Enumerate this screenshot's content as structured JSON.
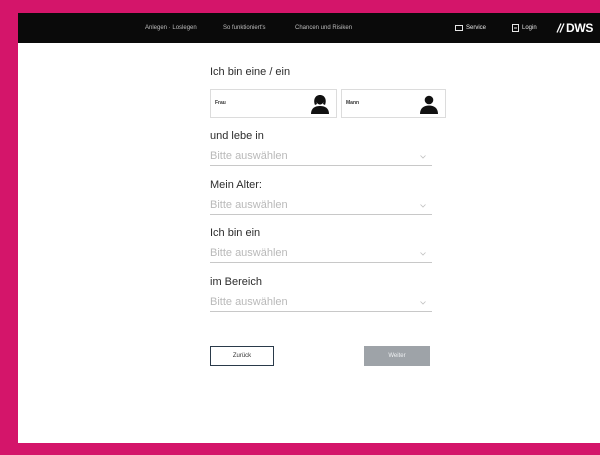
{
  "nav": {
    "links": [
      "Anlegen · Loslegen",
      "So funktioniert's",
      "Chancen und Risiken"
    ],
    "service_label": "Service",
    "login_label": "Login",
    "logo_text": "DWS"
  },
  "form": {
    "gender_question": "Ich bin eine / ein",
    "gender_options": [
      "Frau",
      "Mann"
    ],
    "location_question": "und lebe in",
    "age_question": "Mein Alter:",
    "occupation_question": "Ich bin ein",
    "field_question": "im Bereich",
    "select_placeholder": "Bitte auswählen",
    "back_label": "Zurück",
    "next_label": "Weiter"
  },
  "colors": {
    "border_accent": "#d4156a",
    "navbar": "#0a0a0a",
    "next_button": "#9ea3a8"
  }
}
